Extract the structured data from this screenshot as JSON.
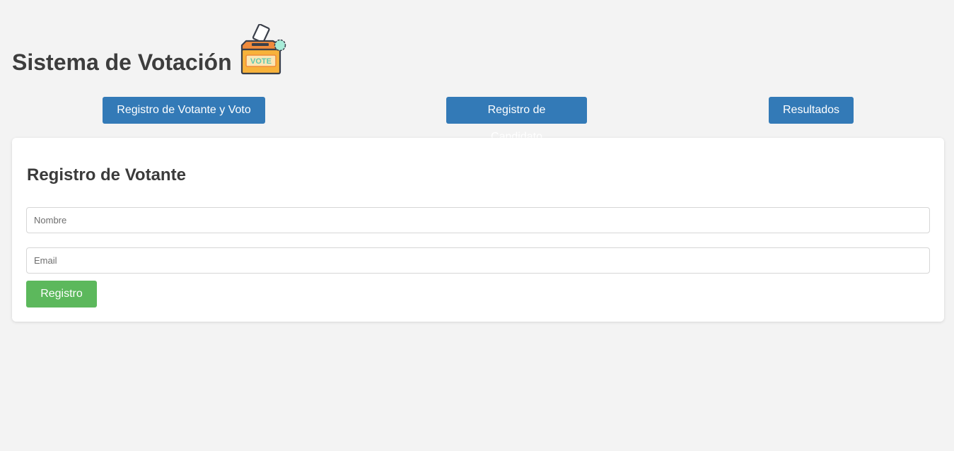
{
  "header": {
    "title": "Sistema de Votación",
    "logo_icon": "ballot-box-icon",
    "logo_text": "VOTE"
  },
  "nav": {
    "voter_label": "Registro de Votante y Voto",
    "candidate_label": "Registro de Candidato",
    "results_label": "Resultados"
  },
  "form": {
    "title": "Registro de Votante",
    "name_placeholder": "Nombre",
    "name_value": "",
    "email_placeholder": "Email",
    "email_value": "",
    "submit_label": "Registro"
  },
  "colors": {
    "background": "#f3f3f3",
    "primary": "#337ab7",
    "success": "#5cb85c",
    "card": "#ffffff"
  }
}
